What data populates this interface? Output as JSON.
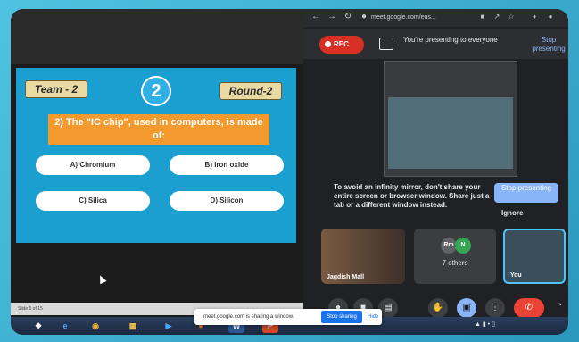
{
  "slide": {
    "team": "Team - 2",
    "number": "2",
    "round": "Round-2",
    "question": "2) The \"IC chip\", used in computers, is made of:",
    "options": [
      "A) Chromium",
      "B) Iron oxide",
      "C) Silica",
      "D) Silicon"
    ],
    "status": "Slide 5 of 15"
  },
  "browser": {
    "url": "meet.google.com/eus..."
  },
  "meet": {
    "rec_label": "REC",
    "presenting_text": "You're presenting to everyone",
    "stop_presenting_link": "Stop presenting",
    "warning_text": "To avoid an infinity mirror, don't share your entire screen or browser window. Share just a tab or a different window instead.",
    "stop_presenting_button": "Stop presenting",
    "ignore_label": "Ignore",
    "participants": [
      {
        "name": "Jagdish Mall"
      },
      {
        "name": "7 others"
      },
      {
        "name": "You"
      }
    ],
    "avatar_initials": [
      "Rm",
      "N"
    ]
  },
  "share_bar": {
    "text": "meet.google.com is sharing a window.",
    "stop_label": "Stop sharing",
    "hide_label": "Hide"
  },
  "colors": {
    "slide_bg": "#1b9ed0",
    "question_bg": "#f29a2e",
    "rec": "#d93025",
    "accent": "#8ab4f8",
    "end_call": "#ea4335"
  }
}
